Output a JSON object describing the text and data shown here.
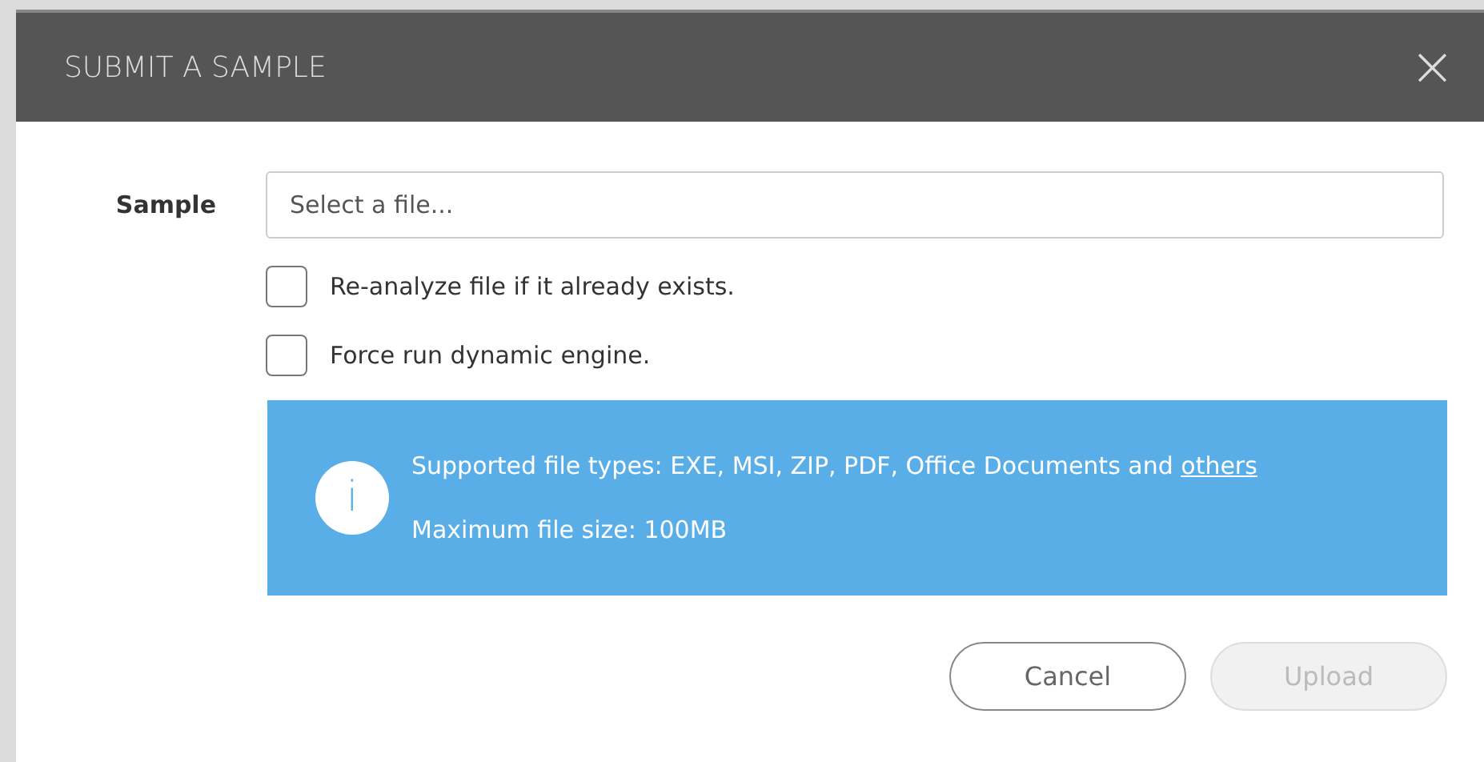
{
  "dialog": {
    "title": "SUBMIT A SAMPLE",
    "close": "×"
  },
  "sample": {
    "label": "Sample",
    "placeholder": "Select a file..."
  },
  "options": [
    {
      "label": "Re-analyze file if it already exists.",
      "checked": false
    },
    {
      "label": "Force run dynamic engine.",
      "checked": false
    }
  ],
  "info": {
    "icon": "i",
    "types_text": "Supported file types: EXE, MSI, ZIP, PDF, Office Documents and ",
    "link": "others",
    "size_text": "Maximum file size: 100MB"
  },
  "buttons": [
    {
      "label": "Cancel",
      "disabled": false
    },
    {
      "label": "Upload",
      "disabled": true
    }
  ]
}
